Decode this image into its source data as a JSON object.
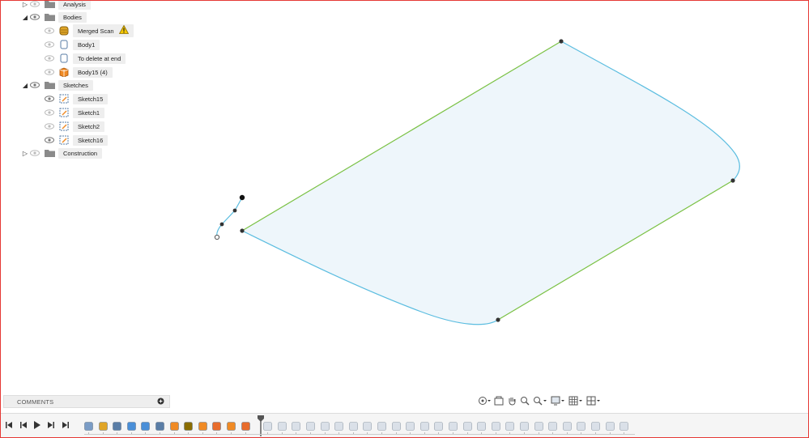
{
  "browser": {
    "nodes": [
      {
        "label": "Analysis",
        "icon": "folder-icon",
        "expanded": false
      },
      {
        "label": "Bodies",
        "icon": "folder-icon",
        "expanded": true
      },
      {
        "label": "Merged Scan",
        "icon": "mesh-body-icon",
        "warning": true
      },
      {
        "label": "Body1",
        "icon": "body-icon"
      },
      {
        "label": "To delete at end",
        "icon": "body-icon"
      },
      {
        "label": "Body15 (4)",
        "icon": "component-body-icon"
      },
      {
        "label": "Sketches",
        "icon": "folder-icon",
        "expanded": true
      },
      {
        "label": "Sketch15",
        "icon": "sketch-icon"
      },
      {
        "label": "Sketch1",
        "icon": "sketch-icon"
      },
      {
        "label": "Sketch2",
        "icon": "sketch-icon"
      },
      {
        "label": "Sketch16",
        "icon": "sketch-icon"
      },
      {
        "label": "Construction",
        "icon": "folder-icon",
        "expanded": false
      }
    ]
  },
  "comments": {
    "label": "COMMENTS"
  },
  "colors": {
    "profile_fill": "#eef6fb",
    "spline": "#5bbde0",
    "line": "#7ac143",
    "point": "#333333",
    "frame": "#e53935"
  },
  "navbar": {
    "tools": [
      "orbit-icon",
      "look-at-icon",
      "pan-icon",
      "zoom-icon",
      "fit-icon",
      "display-settings-icon",
      "grid-icon",
      "viewports-icon"
    ]
  },
  "timeline": {
    "controls": [
      "skip-start-icon",
      "step-back-icon",
      "play-icon",
      "step-forward-icon",
      "skip-end-icon"
    ],
    "item_count": 38,
    "active_count": 12
  }
}
